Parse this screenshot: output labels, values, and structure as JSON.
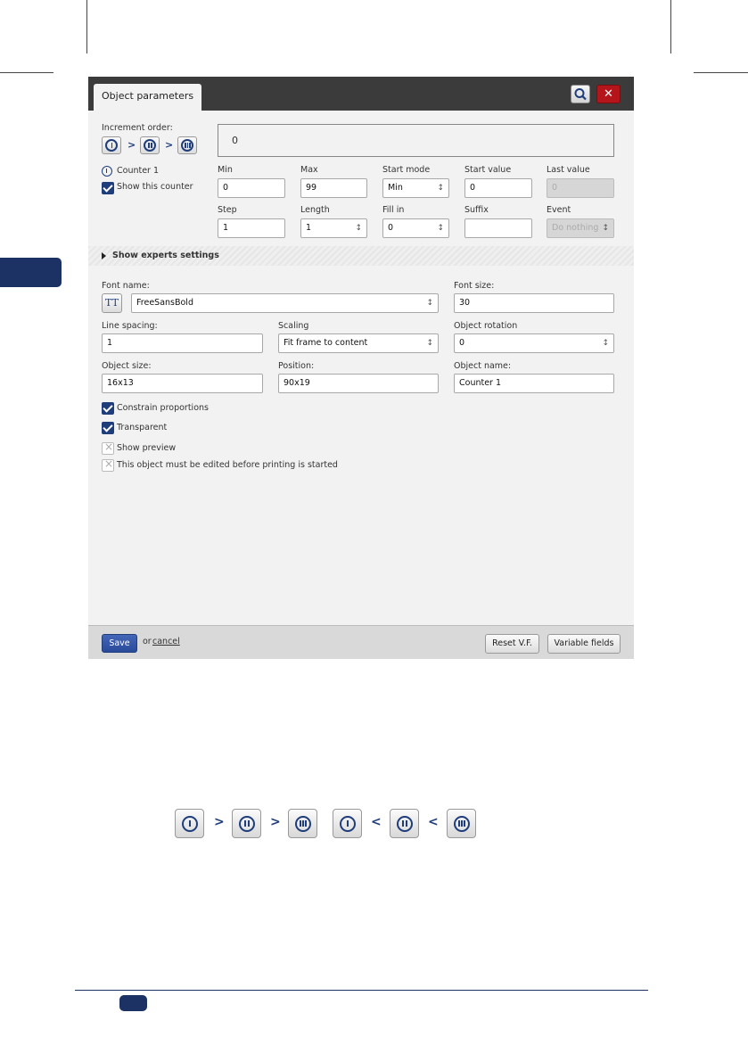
{
  "dialog": {
    "title": "Object parameters",
    "close_symbol": "✕",
    "increment_order_label": "Increment order:",
    "order_sep": ">",
    "preview_value": "0",
    "counter_label": "Counter 1",
    "show_counter_label": "Show this counter",
    "counter": {
      "min": {
        "label": "Min",
        "value": "0"
      },
      "max": {
        "label": "Max",
        "value": "99"
      },
      "start_mode": {
        "label": "Start mode",
        "value": "Min"
      },
      "start_value": {
        "label": "Start value",
        "value": "0"
      },
      "last_value": {
        "label": "Last value",
        "value": "0"
      },
      "step": {
        "label": "Step",
        "value": "1"
      },
      "length": {
        "label": "Length",
        "value": "1"
      },
      "fill_in": {
        "label": "Fill in",
        "value": "0"
      },
      "suffix": {
        "label": "Suffix",
        "value": ""
      },
      "event": {
        "label": "Event",
        "value": "Do nothing"
      }
    },
    "experts_label": "Show experts settings",
    "font_name": {
      "label": "Font name:",
      "value": "FreeSansBold"
    },
    "font_size": {
      "label": "Font size:",
      "value": "30"
    },
    "line_spacing": {
      "label": "Line spacing:",
      "value": "1"
    },
    "scaling": {
      "label": "Scaling",
      "value": "Fit frame to content"
    },
    "object_rotation": {
      "label": "Object rotation",
      "value": "0"
    },
    "object_size": {
      "label": "Object size:",
      "value": "16x13"
    },
    "position": {
      "label": "Position:",
      "value": "90x19"
    },
    "object_name": {
      "label": "Object name:",
      "value": "Counter 1"
    },
    "tt_glyph": "TT",
    "checks": [
      {
        "label": "Constrain proportions",
        "checked": true
      },
      {
        "label": "Transparent",
        "checked": true
      },
      {
        "label": "Show preview",
        "checked": false
      },
      {
        "label": "This object must be edited before printing is started",
        "checked": false
      }
    ],
    "footer": {
      "save": "Save",
      "or": "or",
      "cancel": "cancel",
      "reset": "Reset V.F.",
      "variable_fields": "Variable fields"
    }
  },
  "illustration": {
    "ascending_sep": ">",
    "descending_sep": "<"
  },
  "colors": {
    "accent": "#1f3d7a",
    "close_button": "#b4151b",
    "title_bar": "#3b3b3b"
  }
}
